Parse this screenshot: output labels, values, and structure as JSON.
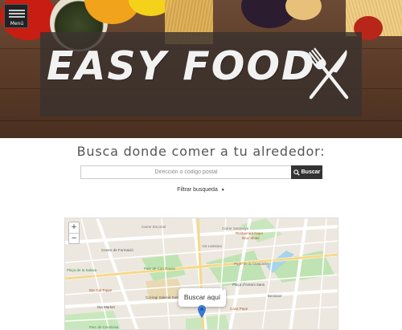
{
  "app": {
    "brand_title": "EASY FOOD",
    "menu_label": "Menú"
  },
  "icons": {
    "menu": "hamburger-icon",
    "brand": "knife-fork-icon",
    "search": "search-icon",
    "filter": "caret-down-icon",
    "pin": "map-pin-icon"
  },
  "search": {
    "heading": "Busca donde comer a tu alrededor:",
    "placeholder": "Dirección o código postal",
    "value": "",
    "button_label": "Buscar"
  },
  "filter": {
    "label": "Filtrar busqueda",
    "caret": "▼"
  },
  "map": {
    "zoom_in": "+",
    "zoom_out": "−",
    "popup_text": "Buscar aquí",
    "popup_close": "×",
    "labels": {
      "street_1": "Carrer Escorial",
      "street_2": "Carrer Sardenya",
      "street_3": "Ptge. de la Ciutadella",
      "street_4": "Via Laietana",
      "restaurant_1": "Restaurant Napo",
      "restaurant_2": "Bruc Motel",
      "poi_1": "Centre de Formació",
      "poi_2": "Parc de Can Rosés",
      "poi_3": "Plaça de la Salasa",
      "poi_4": "Bar Cal Toppe",
      "poi_5": "Col·legi Salesià Sant Antoni de Padua",
      "poi_6": "Plaça d'Antoni Sans",
      "poi_7": "Benisser",
      "poi_8": "Casa Pepe",
      "poi_9": "Dia Market",
      "poi_10": "Parc de Cendrosa"
    }
  },
  "colors": {
    "hero_wood": "#5a3a27",
    "brand_overlay": "#3a322e",
    "button_dark": "#333333",
    "map_bg": "#ede8df",
    "map_park": "#bfe3b3",
    "map_pin": "#3a7bd5"
  }
}
